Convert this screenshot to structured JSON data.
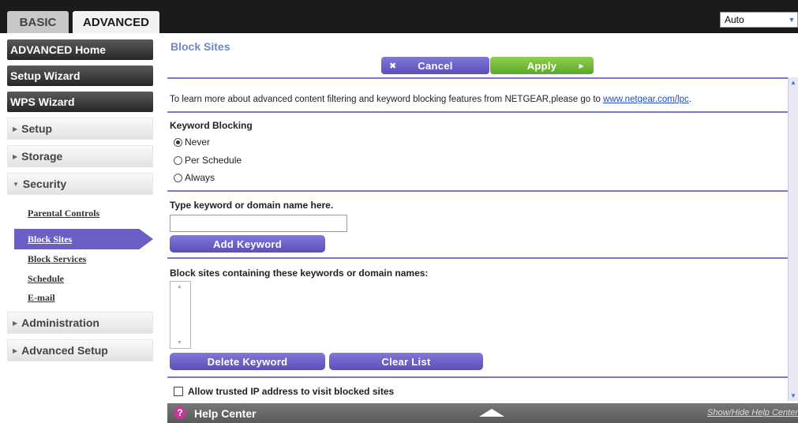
{
  "tabs": {
    "basic": "BASIC",
    "advanced": "ADVANCED"
  },
  "language": {
    "selected": "Auto"
  },
  "sidebar": {
    "advanced_home": "ADVANCED Home",
    "setup_wizard": "Setup Wizard",
    "wps_wizard": "WPS Wizard",
    "setup": "Setup",
    "storage": "Storage",
    "security": "Security",
    "security_items": [
      "Parental Controls",
      "Block Sites",
      "Block Services",
      "Schedule",
      "E-mail"
    ],
    "administration": "Administration",
    "advanced_setup": "Advanced Setup"
  },
  "page": {
    "title": "Block Sites",
    "cancel_label": "Cancel",
    "apply_label": "Apply",
    "info_text": "To learn more about advanced content filtering and keyword blocking features from NETGEAR,please go to ",
    "info_link": "www.netgear.com/lpc",
    "info_suffix": ".",
    "keyword_blocking_heading": "Keyword Blocking",
    "radio_options": [
      "Never",
      "Per Schedule",
      "Always"
    ],
    "selected_radio": "Never",
    "keyword_input_label": "Type keyword or domain name here.",
    "keyword_input_value": "",
    "add_keyword_label": "Add Keyword",
    "blocklist_label": "Block sites containing these keywords or domain names:",
    "delete_keyword_label": "Delete Keyword",
    "clear_list_label": "Clear List",
    "allow_trusted_label": "Allow trusted IP address to visit blocked sites"
  },
  "help": {
    "label": "Help Center",
    "toggle": "Show/Hide Help Center"
  },
  "colors": {
    "accent_purple": "#6b5fc6",
    "apply_green": "#6cb833",
    "title_blue": "#6a88c8"
  },
  "icons": {
    "help": "question-icon",
    "cancel": "x-icon",
    "apply": "triangle-right-icon",
    "expand": "triangle-up-icon"
  }
}
